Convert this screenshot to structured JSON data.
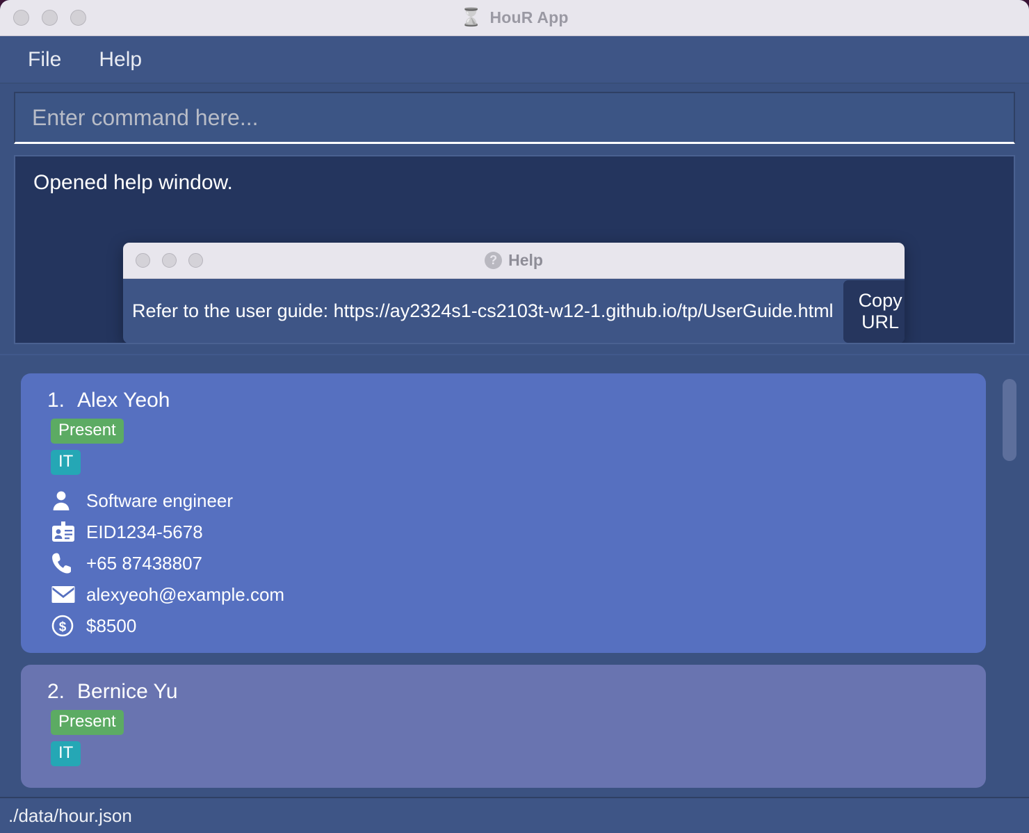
{
  "window": {
    "title": "HouR App",
    "title_icon": "hourglass-icon",
    "traffic_lights": [
      "close",
      "minimize",
      "maximize"
    ]
  },
  "menubar": {
    "items": [
      {
        "label": "File"
      },
      {
        "label": "Help"
      }
    ]
  },
  "command": {
    "value": "",
    "placeholder": "Enter command here..."
  },
  "result": {
    "text": "Opened help window."
  },
  "help_dialog": {
    "title": "Help",
    "title_icon": "question-mark-icon",
    "message": "Refer to the user guide: https://ay2324s1-cs2103t-w12-1.github.io/tp/UserGuide.html",
    "copy_button": "Copy URL",
    "traffic_lights": [
      "close",
      "minimize",
      "maximize"
    ]
  },
  "persons": [
    {
      "index": "1.",
      "name": "Alex Yeoh",
      "attendance": "Present",
      "department": "IT",
      "role": "Software engineer",
      "employee_id": "EID1234-5678",
      "phone": "+65 87438807",
      "email": "alexyeoh@example.com",
      "salary": "$8500",
      "selected": true
    },
    {
      "index": "2.",
      "name": "Bernice Yu",
      "attendance": "Present",
      "department": "IT",
      "role": "",
      "employee_id": "",
      "phone": "",
      "email": "",
      "salary": "",
      "selected": false
    }
  ],
  "status_bar": {
    "file_path": "./data/hour.json"
  },
  "colors": {
    "window_bg": "#3b5281",
    "menubar": "#3e5586",
    "result_panel": "#24355e",
    "card_selected": "#5670c0",
    "card_normal": "#6974b0",
    "tag_present": "#5cab63",
    "tag_department": "#25a7b5",
    "titlebar": "#e8e6ed",
    "copy_button": "#26365e",
    "desktop_bg": "#3b1436"
  }
}
